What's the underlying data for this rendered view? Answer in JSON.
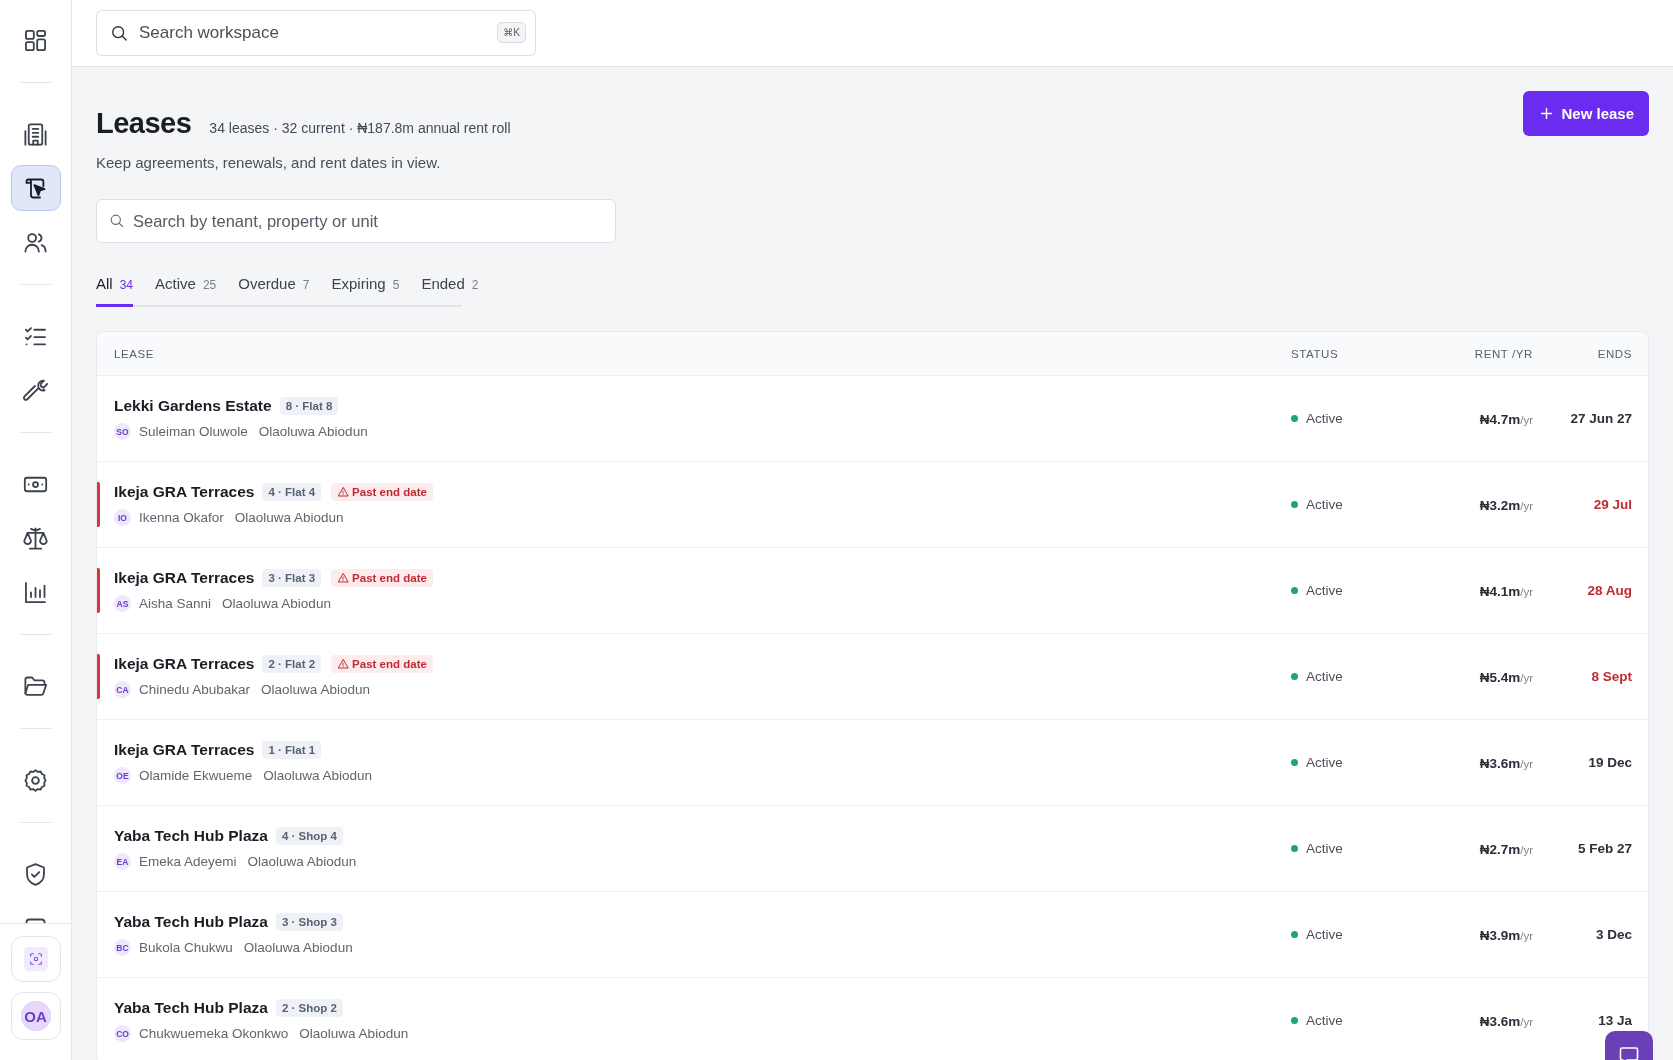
{
  "sidebar": {
    "groups": [
      [
        {
          "selected": false
        }
      ],
      [
        {
          "selected": false
        },
        {
          "selected": true
        },
        {
          "selected": false
        }
      ],
      [
        {
          "selected": false
        },
        {
          "selected": false
        }
      ],
      [
        {
          "selected": false
        },
        {
          "selected": false
        },
        {
          "selected": false
        }
      ],
      [
        {
          "selected": false
        }
      ],
      [
        {
          "selected": false
        }
      ],
      [
        {
          "selected": false
        },
        {
          "selected": false
        }
      ]
    ],
    "avatar": "OA"
  },
  "topbar": {
    "search": {
      "placeholder": "Search workspace",
      "shortcut": "⌘K"
    }
  },
  "header": {
    "title": "Leases",
    "summary": "34 leases · 32 current · ₦187.8m annual rent roll",
    "subtitle": "Keep agreements, renewals, and rent dates in view.",
    "action": "New lease"
  },
  "search": {
    "placeholder": "Search by tenant, property or unit"
  },
  "tabs": [
    {
      "label": "All",
      "count": "34",
      "selected": true
    },
    {
      "label": "Active",
      "count": "25",
      "selected": false
    },
    {
      "label": "Overdue",
      "count": "7",
      "selected": false
    },
    {
      "label": "Expiring",
      "count": "5",
      "selected": false
    },
    {
      "label": "Ended",
      "count": "2",
      "selected": false
    }
  ],
  "table": {
    "columns": [
      "LEASE",
      "STATUS",
      "RENT /YR",
      "ENDS"
    ],
    "rows": [
      {
        "property": "Lekki Gardens Estate",
        "unit": "8 · Flat 8",
        "overdue": false,
        "initials": "SO",
        "tenant": "Suleiman Oluwole",
        "agent": "Olaoluwa Abiodun",
        "status": "Active",
        "color": "#1aa774",
        "rent": "₦4.7m",
        "per": "/yr",
        "ends": "27 Jun 27"
      },
      {
        "property": "Ikeja GRA Terraces",
        "unit": "4 · Flat 4",
        "overdue": true,
        "alert": "Past end date",
        "initials": "IO",
        "tenant": "Ikenna Okafor",
        "agent": "Olaoluwa Abiodun",
        "status": "Active",
        "color": "#1aa774",
        "rent": "₦3.2m",
        "per": "/yr",
        "ends": "29 Jul"
      },
      {
        "property": "Ikeja GRA Terraces",
        "unit": "3 · Flat 3",
        "overdue": true,
        "alert": "Past end date",
        "initials": "AS",
        "tenant": "Aisha Sanni",
        "agent": "Olaoluwa Abiodun",
        "status": "Active",
        "color": "#1aa774",
        "rent": "₦4.1m",
        "per": "/yr",
        "ends": "28 Aug"
      },
      {
        "property": "Ikeja GRA Terraces",
        "unit": "2 · Flat 2",
        "overdue": true,
        "alert": "Past end date",
        "initials": "CA",
        "tenant": "Chinedu Abubakar",
        "agent": "Olaoluwa Abiodun",
        "status": "Active",
        "color": "#1aa774",
        "rent": "₦5.4m",
        "per": "/yr",
        "ends": "8 Sept"
      },
      {
        "property": "Ikeja GRA Terraces",
        "unit": "1 · Flat 1",
        "overdue": false,
        "initials": "OE",
        "tenant": "Olamide Ekwueme",
        "agent": "Olaoluwa Abiodun",
        "status": "Active",
        "color": "#1aa774",
        "rent": "₦3.6m",
        "per": "/yr",
        "ends": "19 Dec"
      },
      {
        "property": "Yaba Tech Hub Plaza",
        "unit": "4 · Shop 4",
        "overdue": false,
        "initials": "EA",
        "tenant": "Emeka Adeyemi",
        "agent": "Olaoluwa Abiodun",
        "status": "Active",
        "color": "#1aa774",
        "rent": "₦2.7m",
        "per": "/yr",
        "ends": "5 Feb 27"
      },
      {
        "property": "Yaba Tech Hub Plaza",
        "unit": "3 · Shop 3",
        "overdue": false,
        "initials": "BC",
        "tenant": "Bukola Chukwu",
        "agent": "Olaoluwa Abiodun",
        "status": "Active",
        "color": "#1aa774",
        "rent": "₦3.9m",
        "per": "/yr",
        "ends": "3 Dec"
      },
      {
        "property": "Yaba Tech Hub Plaza",
        "unit": "2 · Shop 2",
        "overdue": false,
        "initials": "CO",
        "tenant": "Chukwuemeka Okonkwo",
        "agent": "Olaoluwa Abiodun",
        "status": "Active",
        "color": "#1aa774",
        "rent": "₦3.6m",
        "per": "/yr",
        "ends": "13 Ja"
      }
    ]
  }
}
